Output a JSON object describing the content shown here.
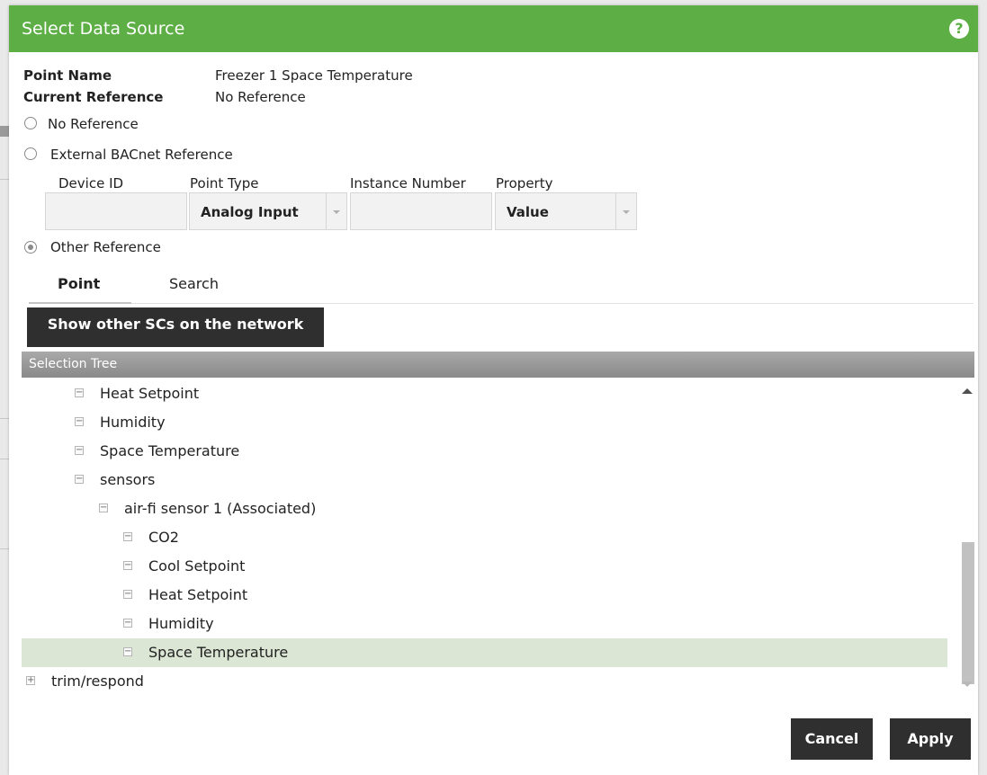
{
  "dialog": {
    "title": "Select Data Source",
    "help_icon": "question-circle-icon"
  },
  "point_info": {
    "point_name_label": "Point Name",
    "point_name_value": "Freezer 1 Space Temperature",
    "current_reference_label": "Current Reference",
    "current_reference_value": "No Reference"
  },
  "reference_options": [
    {
      "label": "No Reference",
      "checked": false
    },
    {
      "label": "External BACnet Reference",
      "checked": false
    },
    {
      "label": "Other Reference",
      "checked": true
    }
  ],
  "bacnet_fields": {
    "device_id_label": "Device ID",
    "device_id_value": "",
    "point_type_label": "Point Type",
    "point_type_value": "Analog Input",
    "instance_number_label": "Instance Number",
    "instance_number_value": "",
    "property_label": "Property",
    "property_value": "Value"
  },
  "tabs": [
    {
      "label": "Point",
      "active": true
    },
    {
      "label": "Search",
      "active": false
    }
  ],
  "show_other_button": "Show other SCs on the network",
  "tree": {
    "header": "Selection Tree",
    "rows": [
      {
        "label": "Heat Setpoint",
        "level": 2,
        "toggle": "−"
      },
      {
        "label": "Humidity",
        "level": 2,
        "toggle": "−"
      },
      {
        "label": "Space Temperature",
        "level": 2,
        "toggle": "−"
      },
      {
        "label": "sensors",
        "level": 2,
        "toggle": "−"
      },
      {
        "label": "air-fi sensor 1 (Associated)",
        "level": 3,
        "toggle": "−"
      },
      {
        "label": "CO2",
        "level": 4,
        "toggle": "−"
      },
      {
        "label": "Cool Setpoint",
        "level": 4,
        "toggle": "−"
      },
      {
        "label": "Heat Setpoint",
        "level": 4,
        "toggle": "−"
      },
      {
        "label": "Humidity",
        "level": 4,
        "toggle": "−"
      },
      {
        "label": "Space Temperature",
        "level": 4,
        "toggle": "−",
        "selected": true
      },
      {
        "label": "trim/respond",
        "level": 0,
        "toggle": "+"
      }
    ]
  },
  "footer": {
    "cancel_label": "Cancel",
    "apply_label": "Apply"
  },
  "colors": {
    "titlebar": "#5cae45",
    "selected_row": "#dbe6d4",
    "dark_button": "#2f2f2f"
  }
}
